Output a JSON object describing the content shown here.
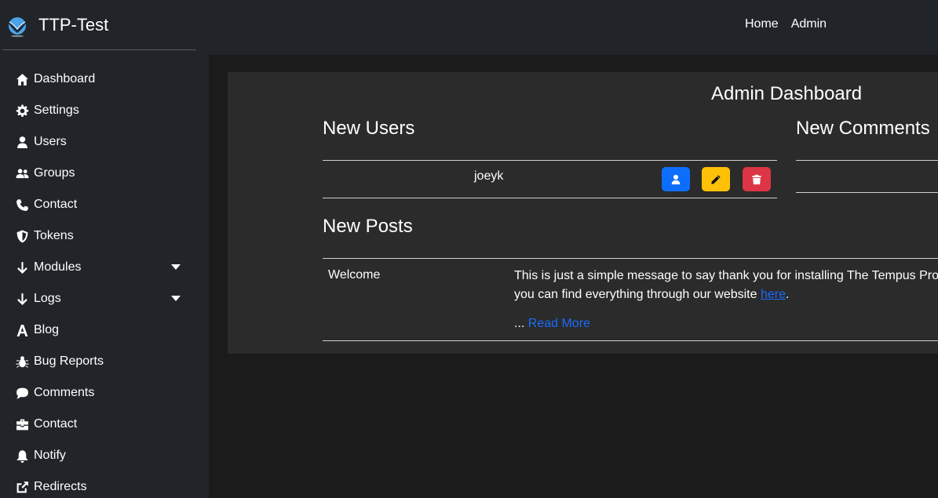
{
  "brand": {
    "name": "TTP-Test"
  },
  "topnav": {
    "items": [
      "Home",
      "Admin"
    ]
  },
  "sidebar": {
    "items": [
      {
        "label": "Dashboard",
        "icon": "home-icon"
      },
      {
        "label": "Settings",
        "icon": "gear-icon"
      },
      {
        "label": "Users",
        "icon": "user-icon"
      },
      {
        "label": "Groups",
        "icon": "users-icon"
      },
      {
        "label": "Contact",
        "icon": "phone-icon"
      },
      {
        "label": "Tokens",
        "icon": "shield-icon"
      },
      {
        "label": "Modules",
        "icon": "arrow-down-icon",
        "dropdown": true
      },
      {
        "label": "Logs",
        "icon": "arrow-down-icon",
        "dropdown": true
      },
      {
        "label": "Blog",
        "icon": "font-icon"
      },
      {
        "label": "Bug Reports",
        "icon": "bug-icon"
      },
      {
        "label": "Comments",
        "icon": "comment-icon"
      },
      {
        "label": "Contact",
        "icon": "briefcase-icon"
      },
      {
        "label": "Notify",
        "icon": "bell-icon"
      },
      {
        "label": "Redirects",
        "icon": "external-link-icon"
      }
    ]
  },
  "main": {
    "title": "Admin Dashboard",
    "new_users": {
      "title": "New Users",
      "rows": [
        {
          "username": "joeyk"
        }
      ]
    },
    "new_comments": {
      "title": "New Comments"
    },
    "new_posts": {
      "title": "New Posts",
      "rows": [
        {
          "title": "Welcome",
          "body_line1": "This is just a simple message to say thank you for installing The Tempus Proje",
          "body_line2_prefix": "you can find everything through our website ",
          "link_text": "here",
          "body_line2_suffix": ".",
          "ellipsis": "... ",
          "read_more": "Read More"
        }
      ]
    }
  },
  "colors": {
    "background": "#1b1b1c",
    "sidebar": "#212529",
    "card": "#2b2b2b",
    "primary": "#0d6efd",
    "warning": "#ffc107",
    "danger": "#dc3545",
    "link": "#1a6cff"
  }
}
